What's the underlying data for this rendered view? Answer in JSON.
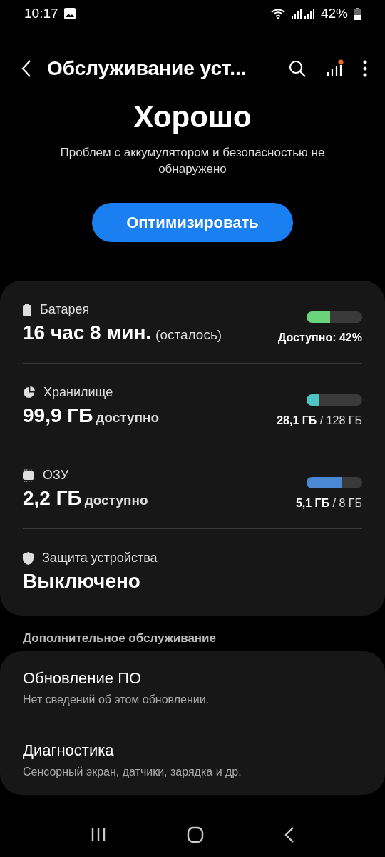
{
  "status_bar": {
    "time": "10:17",
    "battery": "42%"
  },
  "header": {
    "title": "Обслуживание уст..."
  },
  "summary": {
    "title": "Хорошо",
    "message": "Проблем с аккумулятором и безопасностью не обнаружено",
    "button": "Оптимизировать"
  },
  "items": [
    {
      "kind": "meter",
      "label": "Батарея",
      "value": "16 час 8 мин.",
      "suffix": "(осталось)",
      "level": 0.42,
      "color": "#6cd37a",
      "reading": "Доступно: 42%"
    },
    {
      "kind": "meter",
      "label": "Хранилище",
      "value": "99,9 ГБ",
      "suffix": "доступно",
      "level": 0.22,
      "color": "#4fc4c4",
      "reading": "**28,1 ГБ** / 128 ГБ"
    },
    {
      "kind": "meter",
      "label": "ОЗУ",
      "value": "2,2 ГБ",
      "suffix": "доступно",
      "level": 0.64,
      "color": "#4a88d4",
      "reading": "**5,1 ГБ** / 8 ГБ"
    },
    {
      "kind": "status",
      "label": "Защита устройства",
      "value": "Выключено"
    }
  ],
  "more": {
    "title": "Дополнительное обслуживание",
    "items": [
      {
        "title": "Обновление ПО",
        "subtitle": "Нет сведений об этом обновлении."
      },
      {
        "title": "Диагностика",
        "subtitle": "Сенсорный экран, датчики, зарядка и др."
      }
    ]
  }
}
